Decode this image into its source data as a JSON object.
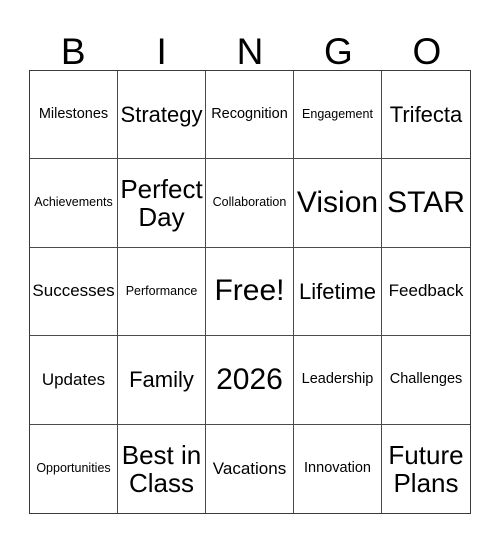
{
  "card": {
    "header_letters": [
      "B",
      "I",
      "N",
      "G",
      "O"
    ],
    "free_space_label": "Free!",
    "grid_line_color": "#4a4a4a",
    "border_color": "#3a3a3a",
    "background_color": "#ffffff",
    "text_color": "#000000",
    "columns": 5,
    "rows": 5,
    "cells": [
      {
        "text": "Milestones",
        "size": "sm"
      },
      {
        "text": "Strategy",
        "size": "lg"
      },
      {
        "text": "Recognition",
        "size": "sm"
      },
      {
        "text": "Engagement",
        "size": "xs"
      },
      {
        "text": "Trifecta",
        "size": "lg"
      },
      {
        "text": "Achievements",
        "size": "xs"
      },
      {
        "text": "Perfect Day",
        "size": "xl"
      },
      {
        "text": "Collaboration",
        "size": "xs"
      },
      {
        "text": "Vision",
        "size": "xxl"
      },
      {
        "text": "STAR",
        "size": "xxl"
      },
      {
        "text": "Successes",
        "size": "md"
      },
      {
        "text": "Performance",
        "size": "xs"
      },
      {
        "text": "Free!",
        "size": "xxl"
      },
      {
        "text": "Lifetime",
        "size": "lg"
      },
      {
        "text": "Feedback",
        "size": "md"
      },
      {
        "text": "Updates",
        "size": "md"
      },
      {
        "text": "Family",
        "size": "lg"
      },
      {
        "text": "2026",
        "size": "xxl"
      },
      {
        "text": "Leadership",
        "size": "sm"
      },
      {
        "text": "Challenges",
        "size": "sm"
      },
      {
        "text": "Opportunities",
        "size": "xs"
      },
      {
        "text": "Best in Class",
        "size": "xl"
      },
      {
        "text": "Vacations",
        "size": "md"
      },
      {
        "text": "Innovation",
        "size": "sm"
      },
      {
        "text": "Future Plans",
        "size": "xl"
      }
    ]
  }
}
